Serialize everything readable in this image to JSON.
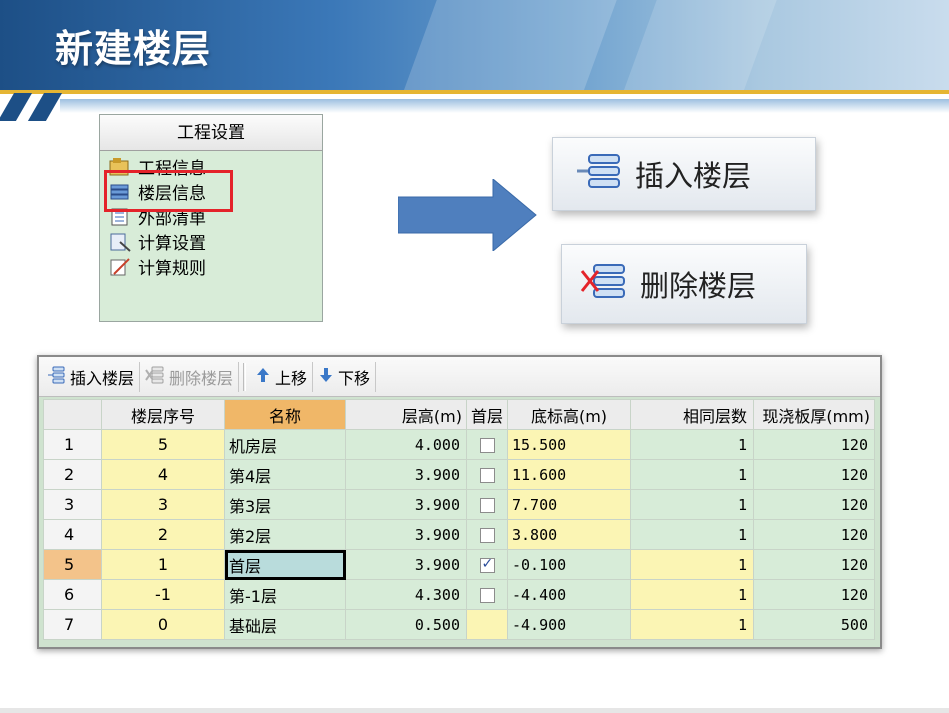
{
  "page": {
    "title": "新建楼层"
  },
  "settings": {
    "header": "工程设置",
    "items": [
      {
        "label": "工程信息",
        "icon": "project-info-icon"
      },
      {
        "label": "楼层信息",
        "icon": "floor-info-icon"
      },
      {
        "label": "外部清单",
        "icon": "external-list-icon"
      },
      {
        "label": "计算设置",
        "icon": "calc-settings-icon"
      },
      {
        "label": "计算规则",
        "icon": "calc-rules-icon"
      }
    ]
  },
  "big_buttons": {
    "insert": "插入楼层",
    "delete": "删除楼层"
  },
  "toolbar": {
    "insert": "插入楼层",
    "delete": "删除楼层",
    "up": "上移",
    "down": "下移"
  },
  "table": {
    "columns": [
      "",
      "楼层序号",
      "名称",
      "层高(m)",
      "首层",
      "底标高(m)",
      "相同层数",
      "现浇板厚(mm)"
    ],
    "rows": [
      {
        "idx": "1",
        "seq": "5",
        "name": "机房层",
        "height": "4.000",
        "first": false,
        "bottom": "15.500",
        "same": "1",
        "thick": "120"
      },
      {
        "idx": "2",
        "seq": "4",
        "name": "第4层",
        "height": "3.900",
        "first": false,
        "bottom": "11.600",
        "same": "1",
        "thick": "120"
      },
      {
        "idx": "3",
        "seq": "3",
        "name": "第3层",
        "height": "3.900",
        "first": false,
        "bottom": "7.700",
        "same": "1",
        "thick": "120"
      },
      {
        "idx": "4",
        "seq": "2",
        "name": "第2层",
        "height": "3.900",
        "first": false,
        "bottom": "3.800",
        "same": "1",
        "thick": "120"
      },
      {
        "idx": "5",
        "seq": "1",
        "name": "首层",
        "height": "3.900",
        "first": true,
        "bottom": "-0.100",
        "same": "1",
        "thick": "120"
      },
      {
        "idx": "6",
        "seq": "-1",
        "name": "第-1层",
        "height": "4.300",
        "first": false,
        "bottom": "-4.400",
        "same": "1",
        "thick": "120"
      },
      {
        "idx": "7",
        "seq": "0",
        "name": "基础层",
        "height": "0.500",
        "first": null,
        "bottom": "-4.900",
        "same": "1",
        "thick": "500"
      }
    ]
  },
  "colors": {
    "accent": "#e4232a",
    "header": "#1d4f86",
    "gold": "#e5b533"
  }
}
